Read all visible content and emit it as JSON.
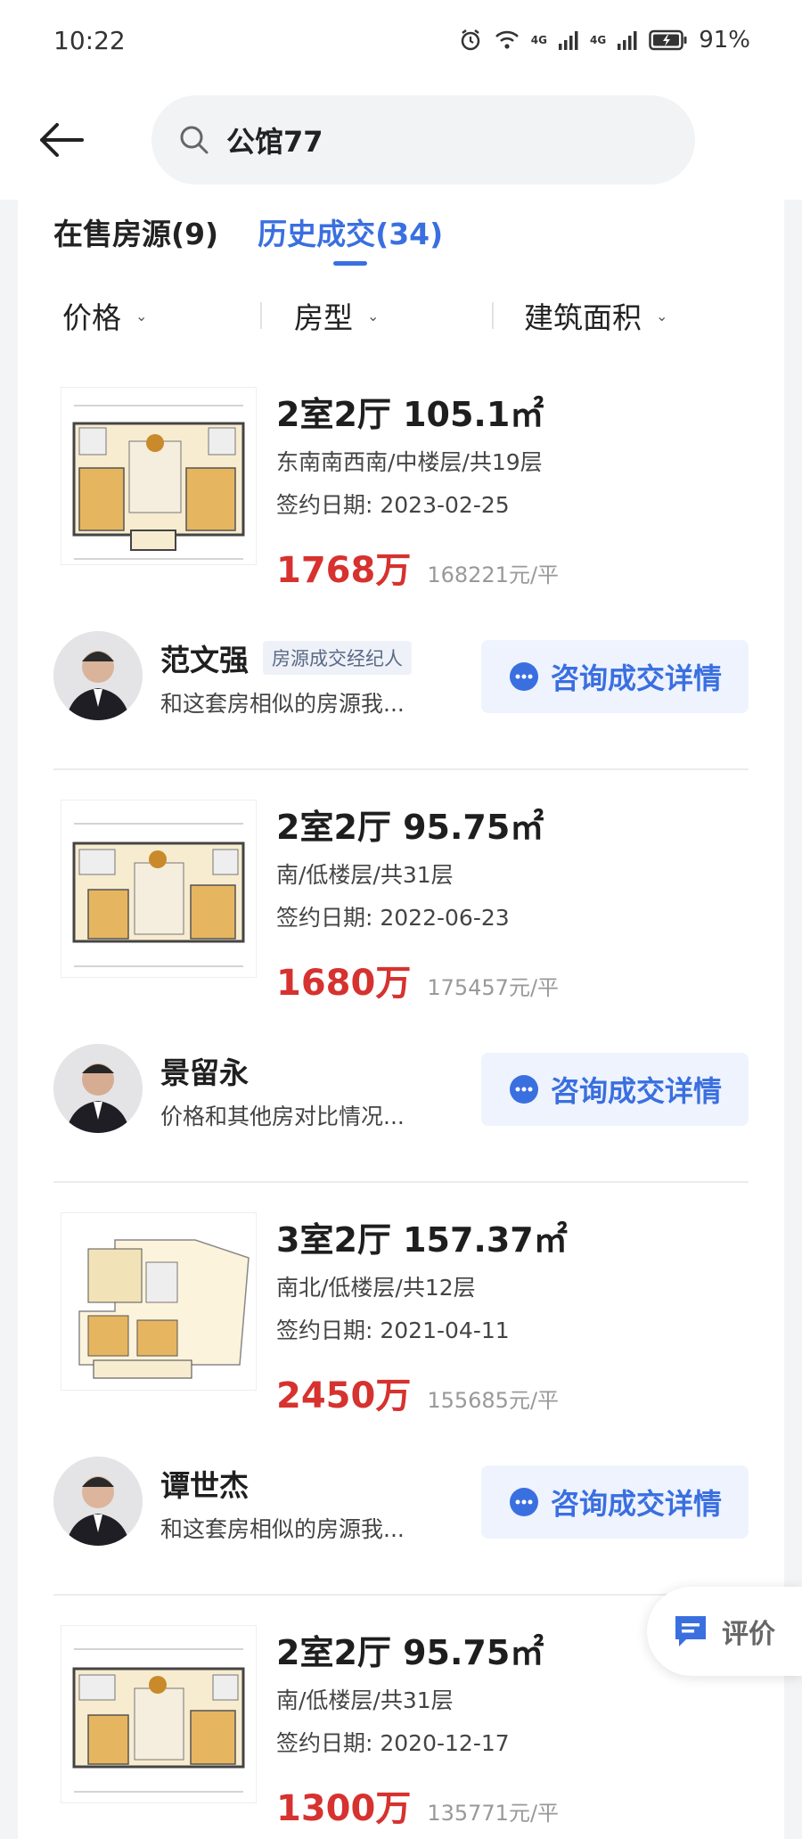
{
  "status_bar": {
    "time": "10:22",
    "network_a": "4G",
    "network_b": "4G",
    "battery": "91%"
  },
  "search": {
    "query": "公馆77"
  },
  "tabs": [
    {
      "label": "在售房源(9)",
      "active": false
    },
    {
      "label": "历史成交(34)",
      "active": true
    }
  ],
  "filters": [
    {
      "label": "价格"
    },
    {
      "label": "房型"
    },
    {
      "label": "建筑面积"
    }
  ],
  "listings": [
    {
      "title": "2室2厅 105.1㎡",
      "meta": "东南南西南/中楼层/共19层",
      "date": "签约日期: 2023-02-25",
      "price": "1768万",
      "unit_price": "168221元/平",
      "agent": {
        "name": "范文强",
        "badge": "房源成交经纪人",
        "message": "和这套房相似的房源我...",
        "button": "咨询成交详情"
      }
    },
    {
      "title": "2室2厅 95.75㎡",
      "meta": "南/低楼层/共31层",
      "date": "签约日期: 2022-06-23",
      "price": "1680万",
      "unit_price": "175457元/平",
      "agent": {
        "name": "景留永",
        "badge": "",
        "message": "价格和其他房对比情况...",
        "button": "咨询成交详情"
      }
    },
    {
      "title": "3室2厅 157.37㎡",
      "meta": "南北/低楼层/共12层",
      "date": "签约日期: 2021-04-11",
      "price": "2450万",
      "unit_price": "155685元/平",
      "agent": {
        "name": "谭世杰",
        "badge": "",
        "message": "和这套房相似的房源我...",
        "button": "咨询成交详情"
      }
    },
    {
      "title": "2室2厅 95.75㎡",
      "meta": "南/低楼层/共31层",
      "date": "签约日期: 2020-12-17",
      "price": "1300万",
      "unit_price": "135771元/平"
    }
  ],
  "floating": {
    "evaluate_label": "评价"
  },
  "colors": {
    "accent": "#3a6fe0",
    "price": "#d6322f",
    "consult_bg": "#eef3fe"
  }
}
